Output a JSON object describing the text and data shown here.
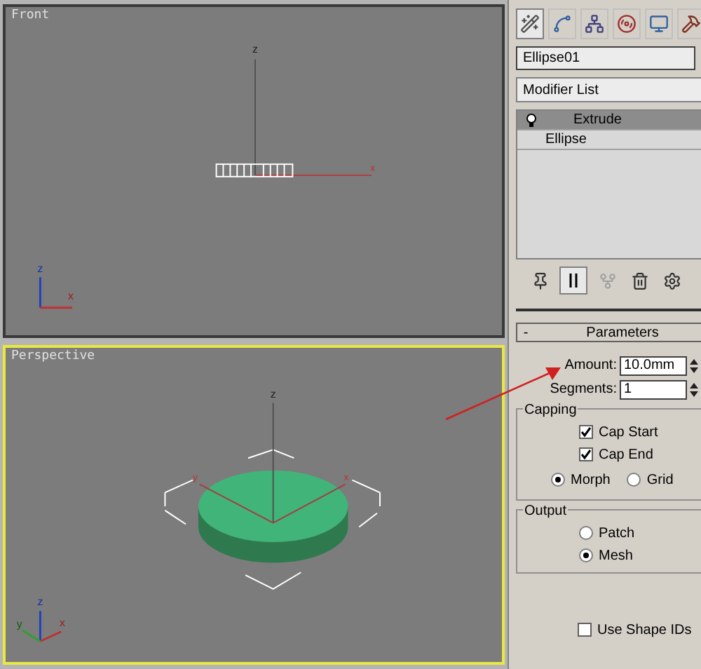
{
  "viewports": [
    {
      "label": "Front",
      "active": false,
      "kind": "front",
      "axis_labels": [
        "z",
        "x"
      ],
      "tripod_labels": [
        "z",
        "x"
      ]
    },
    {
      "label": "Perspective",
      "active": true,
      "kind": "perspective",
      "axis_labels": [
        "z",
        "y",
        "x"
      ],
      "tripod_labels": [
        "z",
        "y",
        "x"
      ]
    }
  ],
  "command_panel": {
    "object_name": "Ellipse01",
    "modifier_list": "Modifier List",
    "stack": [
      {
        "label": "Extrude",
        "selected": true,
        "bulb": true
      },
      {
        "label": "Ellipse",
        "selected": false,
        "bulb": false
      }
    ],
    "rollout": {
      "title": "Parameters",
      "toggle": "-",
      "fields": [
        {
          "label": "Amount:",
          "value": "10.0mm"
        },
        {
          "label": "Segments:",
          "value": "1"
        }
      ],
      "groups": [
        {
          "title": "Capping",
          "items": [
            {
              "kind": "checkbox",
              "label": "Cap Start",
              "checked": true
            },
            {
              "kind": "checkbox",
              "label": "Cap End",
              "checked": true
            },
            {
              "kind": "radios",
              "options": [
                {
                  "label": "Morph",
                  "selected": true
                },
                {
                  "label": "Grid",
                  "selected": false
                }
              ]
            }
          ]
        },
        {
          "title": "Output",
          "items": [
            {
              "kind": "radio",
              "label": "Patch",
              "selected": false
            },
            {
              "kind": "radio",
              "label": "Mesh",
              "selected": true
            }
          ]
        }
      ],
      "extra": [
        {
          "kind": "checkbox",
          "label": "Use Shape IDs",
          "checked": false
        }
      ]
    }
  }
}
